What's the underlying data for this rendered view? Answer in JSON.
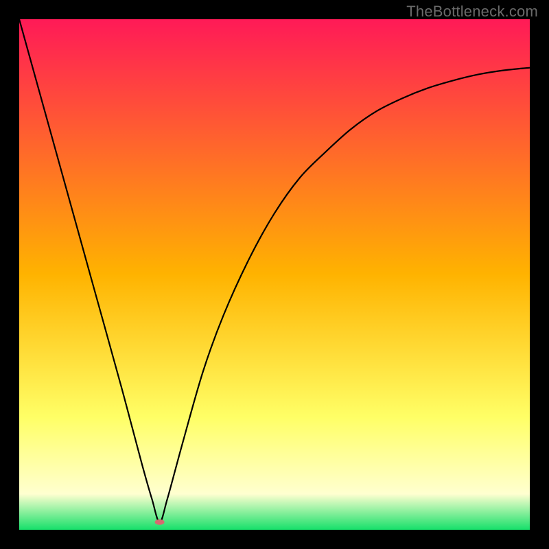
{
  "watermark": "TheBottleneck.com",
  "chart_data": {
    "type": "line",
    "title": "",
    "xlabel": "",
    "ylabel": "",
    "xlim": [
      0,
      100
    ],
    "ylim": [
      0,
      100
    ],
    "grid": false,
    "legend": false,
    "background_gradient": {
      "stops": [
        {
          "offset": 0.0,
          "color": "#ff1a57"
        },
        {
          "offset": 0.5,
          "color": "#ffb300"
        },
        {
          "offset": 0.78,
          "color": "#ffff66"
        },
        {
          "offset": 0.93,
          "color": "#ffffd0"
        },
        {
          "offset": 1.0,
          "color": "#16e06a"
        }
      ]
    },
    "series": [
      {
        "name": "bottleneck-curve",
        "color": "#000000",
        "x": [
          0,
          5,
          10,
          15,
          20,
          24,
          26,
          27.5,
          29,
          32,
          36,
          40,
          45,
          50,
          55,
          60,
          65,
          70,
          75,
          80,
          85,
          90,
          95,
          100
        ],
        "values": [
          100,
          82,
          64,
          46,
          28,
          13,
          6,
          1.5,
          6,
          17,
          31,
          42,
          53,
          62,
          69,
          74,
          78.5,
          82,
          84.5,
          86.5,
          88,
          89.2,
          90,
          90.5
        ]
      }
    ],
    "marker": {
      "x": 27.5,
      "y": 1.5,
      "color": "#d66a70",
      "rx": 7,
      "ry": 4
    }
  }
}
